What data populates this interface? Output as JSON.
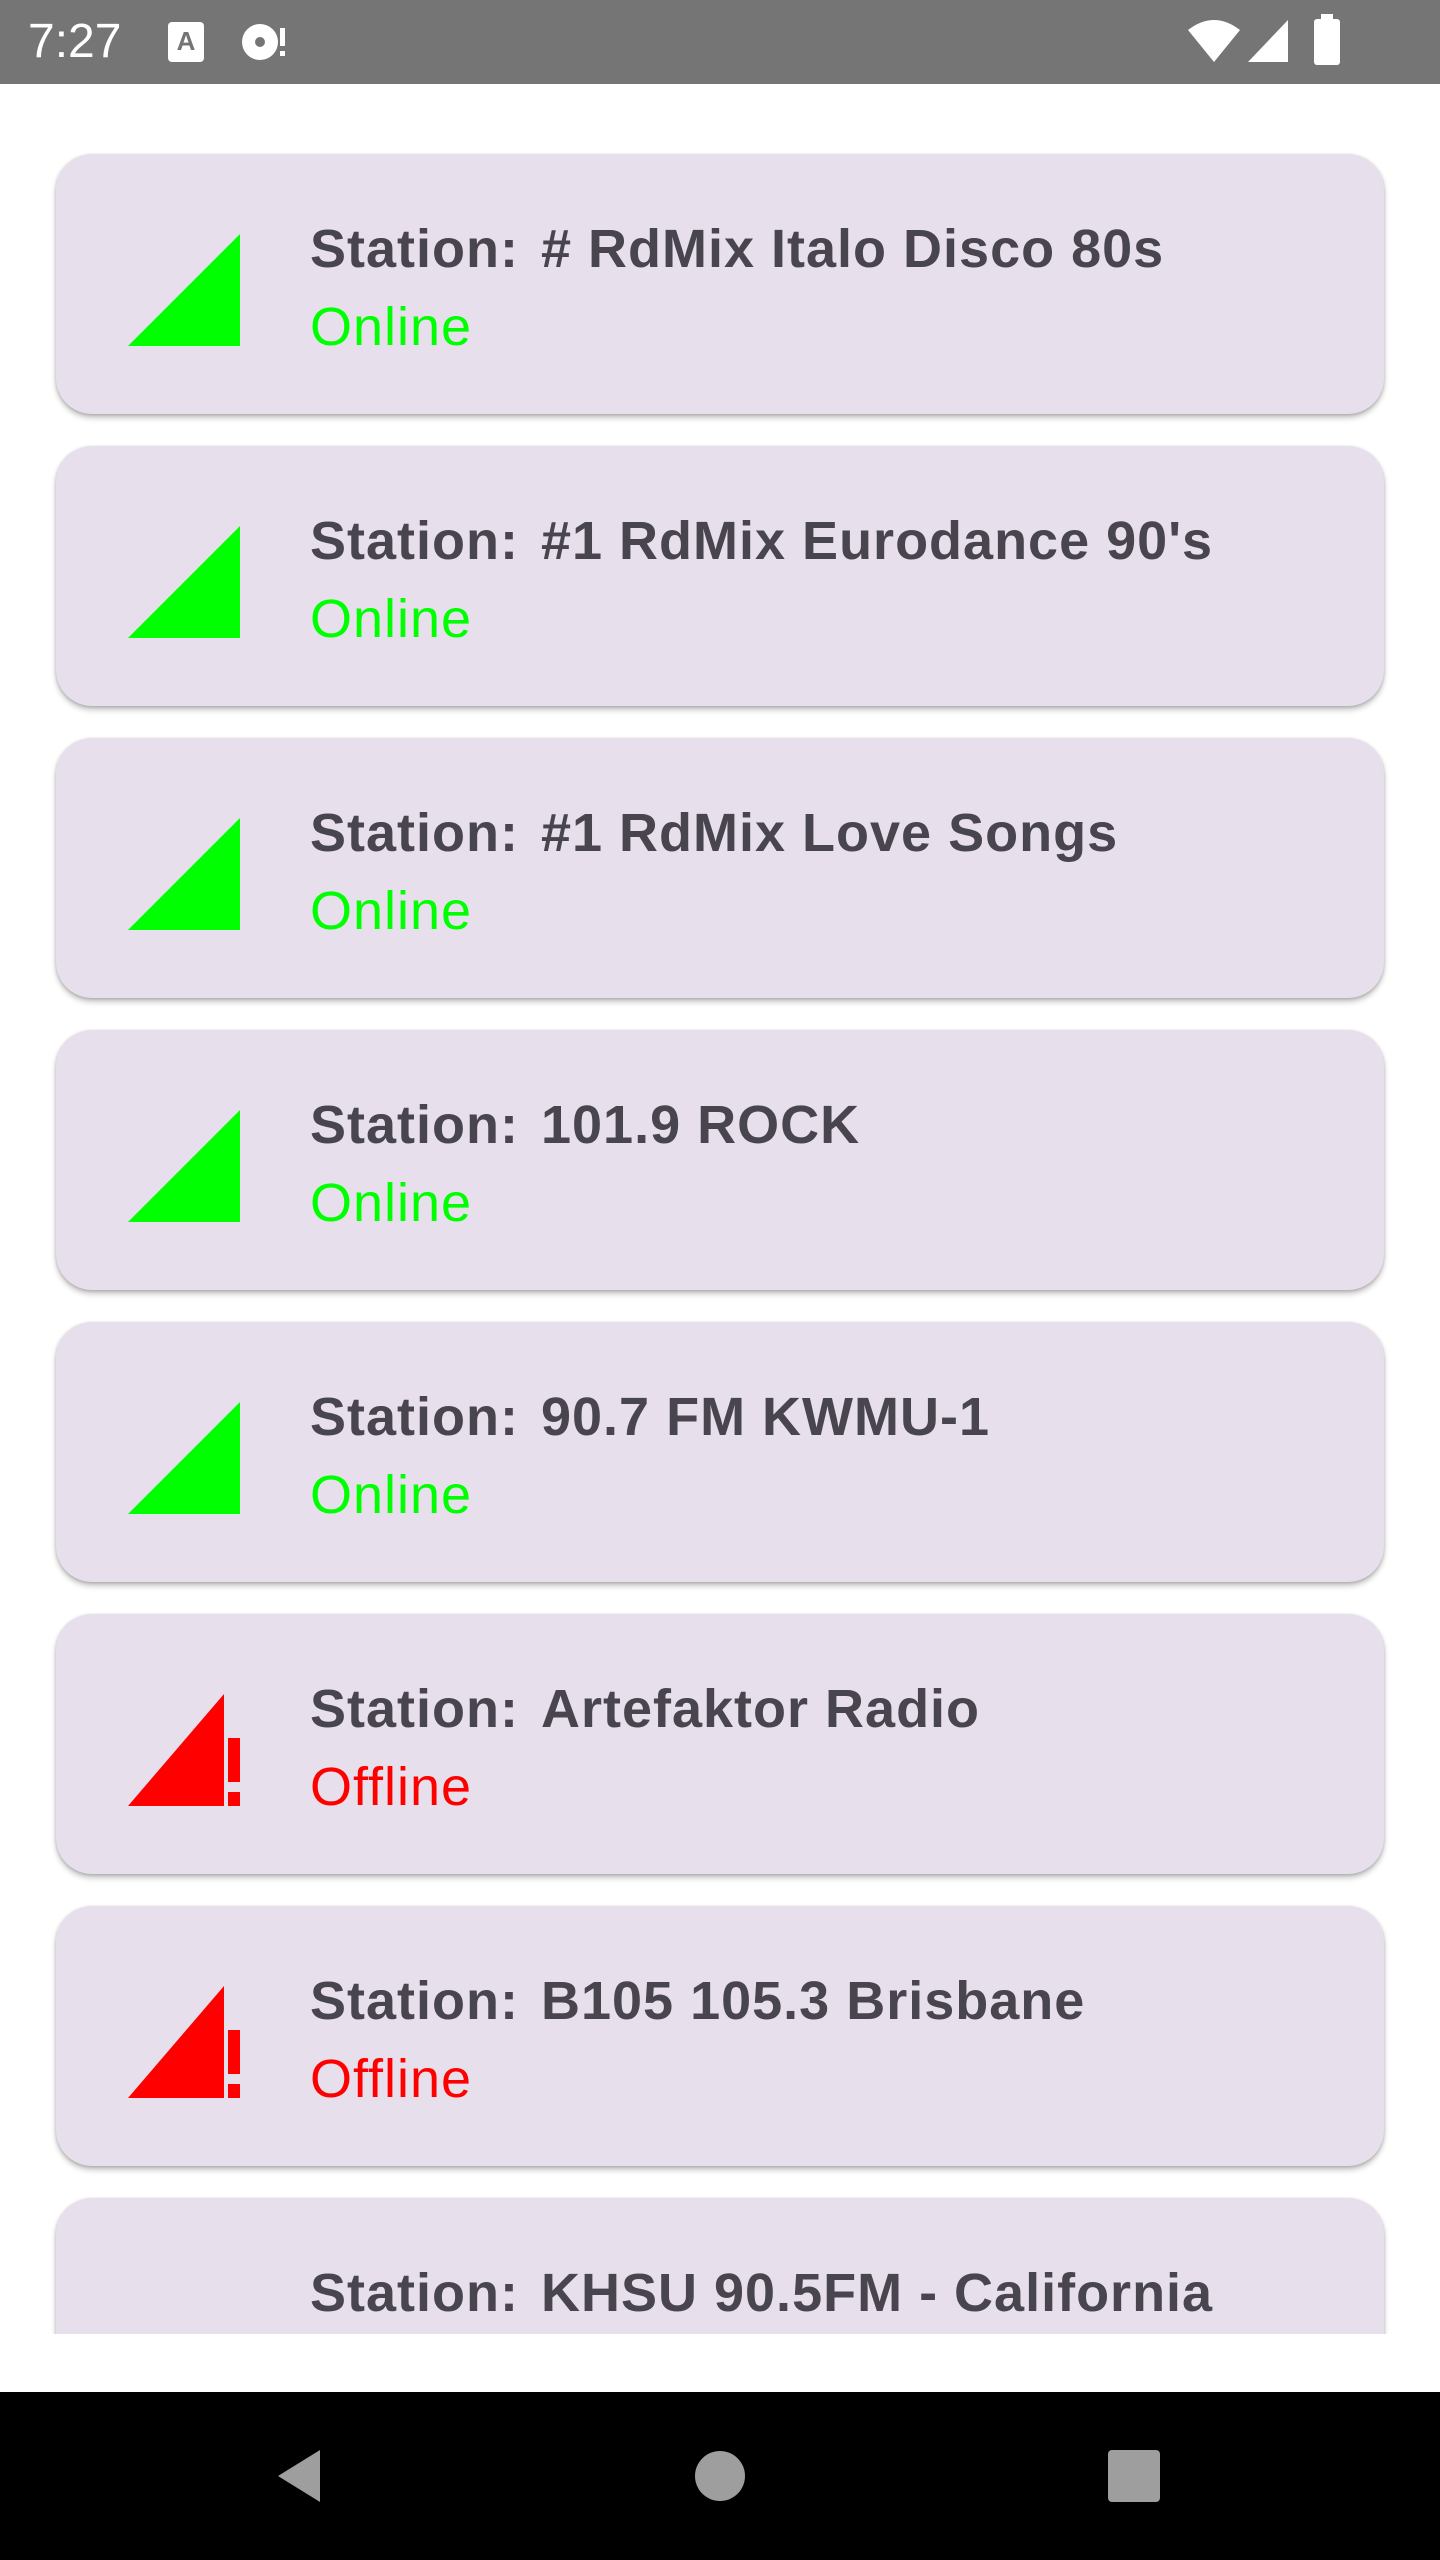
{
  "status_bar": {
    "time": "7:27",
    "icons": [
      "keyboard-a-icon",
      "media-icon",
      "wifi-icon",
      "signal-icon",
      "battery-icon"
    ]
  },
  "stations": [
    {
      "label": "Station:",
      "name": "# RdMix Italo Disco 80s",
      "status": "Online",
      "online": true
    },
    {
      "label": "Station:",
      "name": "#1 RdMix Eurodance 90's",
      "status": "Online",
      "online": true
    },
    {
      "label": "Station:",
      "name": "#1 RdMix Love Songs",
      "status": "Online",
      "online": true
    },
    {
      "label": "Station:",
      "name": "101.9 ROCK",
      "status": "Online",
      "online": true
    },
    {
      "label": "Station:",
      "name": "90.7 FM KWMU-1",
      "status": "Online",
      "online": true
    },
    {
      "label": "Station:",
      "name": "Artefaktor Radio",
      "status": "Offline",
      "online": false
    },
    {
      "label": "Station:",
      "name": "B105 105.3 Brisbane",
      "status": "Offline",
      "online": false
    },
    {
      "label": "Station:",
      "name": "KHSU 90.5FM - California",
      "status": "",
      "online": null
    }
  ],
  "colors": {
    "online": "#00ff00",
    "offline": "#ff0000",
    "card_bg": "#e7e0ec",
    "name_text": "#49454f"
  },
  "nav_bar": {
    "buttons": [
      "back-icon",
      "home-icon",
      "recents-icon"
    ]
  }
}
